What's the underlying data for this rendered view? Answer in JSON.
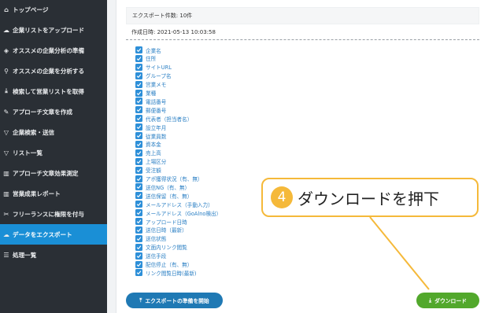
{
  "sidebar": {
    "items": [
      {
        "label": "トップページ",
        "icon": "home-icon",
        "glyph": "⌂",
        "active": false
      },
      {
        "label": "企業リストをアップロード",
        "icon": "upload-icon",
        "glyph": "☁",
        "active": false
      },
      {
        "label": "オススメの企業分析の準備",
        "icon": "layers-icon",
        "glyph": "◈",
        "active": false
      },
      {
        "label": "オススメの企業を分析する",
        "icon": "search-icon",
        "glyph": "⚲",
        "active": false
      },
      {
        "label": "検索して営業リストを取得",
        "icon": "download-icon",
        "glyph": "⤓",
        "active": false
      },
      {
        "label": "アプローチ文章を作成",
        "icon": "pen-icon",
        "glyph": "✎",
        "active": false
      },
      {
        "label": "企業検索・送信",
        "icon": "filter-icon",
        "glyph": "▽",
        "active": false
      },
      {
        "label": "リスト一覧",
        "icon": "list-filter-icon",
        "glyph": "▽",
        "active": false
      },
      {
        "label": "アプローチ文章効果測定",
        "icon": "bar-chart-icon",
        "glyph": "▥",
        "active": false
      },
      {
        "label": "営業成果レポート",
        "icon": "report-icon",
        "glyph": "▥",
        "active": false
      },
      {
        "label": "フリーランスに権限を付与",
        "icon": "tools-icon",
        "glyph": "✂",
        "active": false
      },
      {
        "label": "データをエクスポート",
        "icon": "cloud-export-icon",
        "glyph": "☁",
        "active": true
      },
      {
        "label": "処理一覧",
        "icon": "list-icon",
        "glyph": "☰",
        "active": false
      }
    ]
  },
  "export_info": {
    "count_text": "エクスポート件数: 10件",
    "created_text": "作成日時: 2021-05-13 10:03:58"
  },
  "fields": [
    "企業名",
    "住所",
    "サイトURL",
    "グループ名",
    "営業メモ",
    "業種",
    "電話番号",
    "郵便番号",
    "代表者（担当者名）",
    "設立年月",
    "従業員数",
    "資本金",
    "売上高",
    "上場区分",
    "受注額",
    "アポ獲得状況（有、無）",
    "送信NG（有、無）",
    "送信保留（有、無）",
    "メールアドレス（手動入力）",
    "メールアドレス（GoAlno検出）",
    "アップロード日時",
    "送信日時（最新）",
    "送信状態",
    "文面内リンク閲覧",
    "送信手段",
    "配信停止（有、無）",
    "リンク閲覧日時(最新)"
  ],
  "buttons": {
    "prepare_label": "エクスポートの準備を開始",
    "download_label": "ダウンロード"
  },
  "callout": {
    "number": "4",
    "text": "ダウンロードを押下"
  },
  "colors": {
    "sidebar_bg": "#2a2f35",
    "active_item": "#1a8fd6",
    "checkbox": "#2d8fd8",
    "prepare_button": "#1f79b4",
    "download_button": "#52a82c",
    "callout_accent": "#f5b93a"
  }
}
